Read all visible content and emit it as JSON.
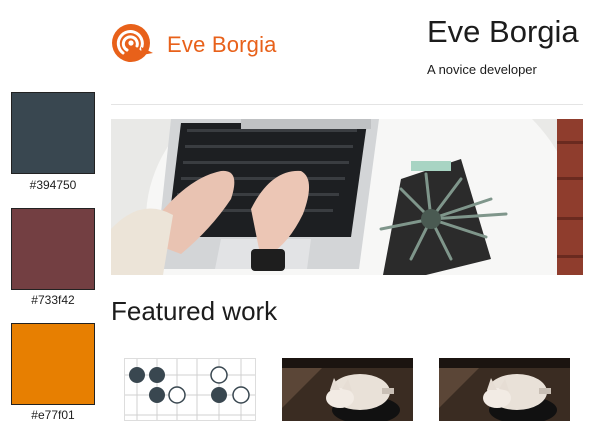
{
  "palette": {
    "swatches": [
      {
        "color": "#394750",
        "label": "#394750"
      },
      {
        "color": "#733f42",
        "label": "#733f42"
      },
      {
        "color": "#e77f01",
        "label": "#e77f01"
      }
    ]
  },
  "header": {
    "brand_name": "Eve Borgia",
    "site_title": "Eve Borgia",
    "tagline": "A novice developer",
    "logo_icon": "broadcast-spiral-logo-icon",
    "brand_color": "#e8611a"
  },
  "featured": {
    "heading": "Featured work",
    "items": [
      {
        "icon": "go-board-icon"
      },
      {
        "icon": "cat-photo"
      },
      {
        "icon": "cat-photo"
      }
    ]
  }
}
